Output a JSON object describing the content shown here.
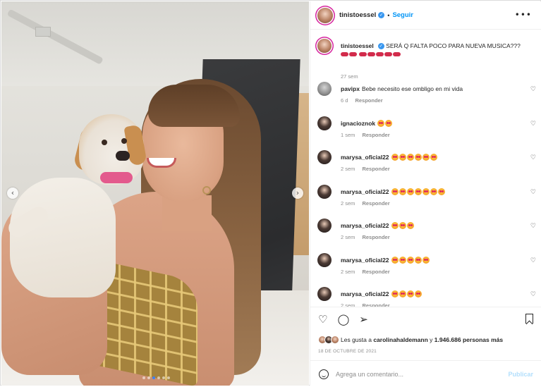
{
  "post": {
    "username": "tinistoessel",
    "verified_badge": "✓",
    "separator": "•",
    "follow_label": "Seguir",
    "more_icon": "more-horizontal-icon",
    "caption": "SERÁ Q FALTA POCO PARA NUEVA MUSICA???",
    "caption_time": "27 sem"
  },
  "comments": [
    {
      "username": "pavipx",
      "text": "Bebe necesito ese ombligo en mi vida",
      "emoji_count": 0,
      "time": "6 d",
      "reply": "Responder"
    },
    {
      "username": "ignacioznok",
      "text": "",
      "emoji_count": 2,
      "time": "1 sem",
      "reply": "Responder"
    },
    {
      "username": "marysa_oficial22",
      "text": "",
      "emoji_count": 6,
      "time": "2 sem",
      "reply": "Responder"
    },
    {
      "username": "marysa_oficial22",
      "text": "",
      "emoji_count": 7,
      "time": "2 sem",
      "reply": "Responder"
    },
    {
      "username": "marysa_oficial22",
      "text": "",
      "emoji_count": 3,
      "time": "2 sem",
      "reply": "Responder"
    },
    {
      "username": "marysa_oficial22",
      "text": "",
      "emoji_count": 5,
      "time": "2 sem",
      "reply": "Responder"
    },
    {
      "username": "marysa_oficial22",
      "text": "",
      "emoji_count": 4,
      "time": "2 sem",
      "reply": "Responder"
    }
  ],
  "actions": {
    "like_icon": "heart-icon",
    "comment_icon": "comment-icon",
    "share_icon": "share-icon",
    "save_icon": "bookmark-icon",
    "likes_prefix": "Les gusta a",
    "likes_user": "carolinahaldemann",
    "likes_middle": "y",
    "likes_count": "1.946.686 personas más",
    "date": "18 DE OCTUBRE DE 2021"
  },
  "composer": {
    "placeholder": "Agrega un comentario...",
    "publish_label": "Publicar"
  },
  "carousel": {
    "prev_icon": "chevron-left-icon",
    "next_icon": "chevron-right-icon",
    "slide_count": 6,
    "active_slide": 2
  },
  "colors": {
    "accent": "#0095f6",
    "verified": "#3897f0",
    "muted": "#8e8e8e"
  }
}
